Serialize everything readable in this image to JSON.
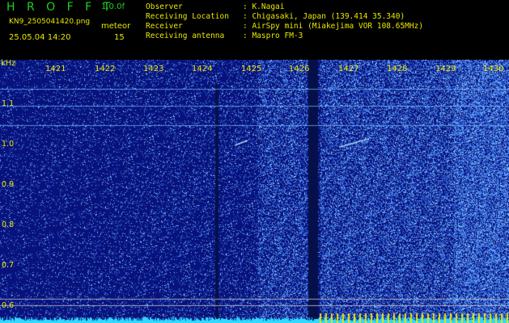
{
  "header": {
    "app_title": "H R O F F T",
    "version": "1.0.0f",
    "filename": "KN9_2505041420.png",
    "mode": "meteor",
    "datetime": "25.05.04 14:20",
    "count": "15"
  },
  "info": [
    {
      "label": "Observer",
      "value": ": K.Nagai"
    },
    {
      "label": "Receiving Location",
      "value": ": Chigasaki, Japan (139.414 35.340)"
    },
    {
      "label": "Receiver",
      "value": ": AirSpy mini (Miakejima VOR 108.65MHz)"
    },
    {
      "label": "Receiving antenna",
      "value": ": Maspro FM-3"
    }
  ],
  "axes": {
    "y_unit": "kHz",
    "y_ticks": [
      "1.1",
      "1.0",
      "0.9",
      "0.8",
      "0.7",
      "0.6"
    ],
    "x_ticks": [
      "1421",
      "1422",
      "1423",
      "1424",
      "1425",
      "1426",
      "1427",
      "1428",
      "1429",
      "1430"
    ]
  },
  "colors": {
    "header_text": "#e8e800",
    "title_green": "#1fd11f",
    "background": "#000000",
    "spectrogram_base": "#0a1a8a"
  }
}
